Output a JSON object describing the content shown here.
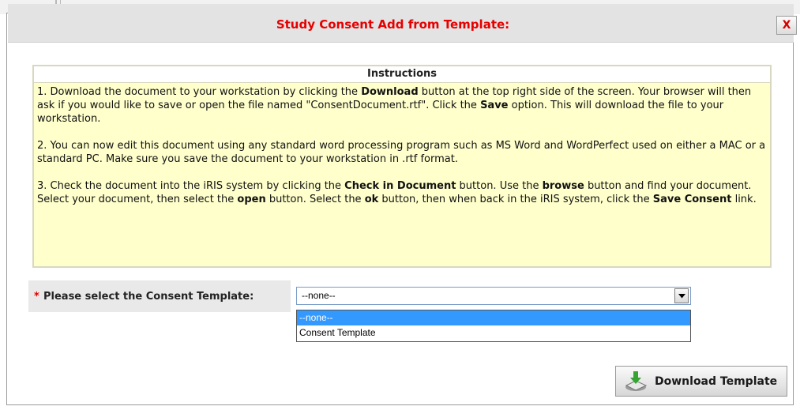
{
  "dialog": {
    "title": "Study Consent Add from Template:",
    "close_label": "X"
  },
  "instructions": {
    "header": "Instructions",
    "steps": [
      [
        {
          "t": "1. Download the document to your workstation by clicking the ",
          "b": false
        },
        {
          "t": "Download",
          "b": true
        },
        {
          "t": " button at the top right side of the screen. Your browser will then ask if you would like to save or open the file named \"ConsentDocument.rtf\". Click the ",
          "b": false
        },
        {
          "t": "Save",
          "b": true
        },
        {
          "t": " option. This will download the file to your workstation.",
          "b": false
        }
      ],
      [
        {
          "t": "2. You can now edit this document using any standard word processing program such as MS Word and WordPerfect used on either a MAC or a standard PC. Make sure you save the document to your workstation in .rtf format.",
          "b": false
        }
      ],
      [
        {
          "t": "3. Check the document into the iRIS system by clicking the ",
          "b": false
        },
        {
          "t": "Check in Document",
          "b": true
        },
        {
          "t": " button. Use the ",
          "b": false
        },
        {
          "t": "browse",
          "b": true
        },
        {
          "t": " button and find your document. Select your document, then select the ",
          "b": false
        },
        {
          "t": "open",
          "b": true
        },
        {
          "t": " button. Select the ",
          "b": false
        },
        {
          "t": "ok",
          "b": true
        },
        {
          "t": " button, then when back in the iRIS system, click the ",
          "b": false
        },
        {
          "t": "Save Consent",
          "b": true
        },
        {
          "t": " link.",
          "b": false
        }
      ]
    ]
  },
  "template_select": {
    "required_mark": "*",
    "label": "Please select the Consent Template:",
    "selected_value": "--none--",
    "options": [
      "--none--",
      "Consent Template"
    ],
    "highlighted_index": 0
  },
  "download_button": {
    "label": "Download Template",
    "icon": "download-icon"
  },
  "colors": {
    "title": "#e60000",
    "instructions_bg": "#ffffcc",
    "selected_option": "#3399ff"
  }
}
